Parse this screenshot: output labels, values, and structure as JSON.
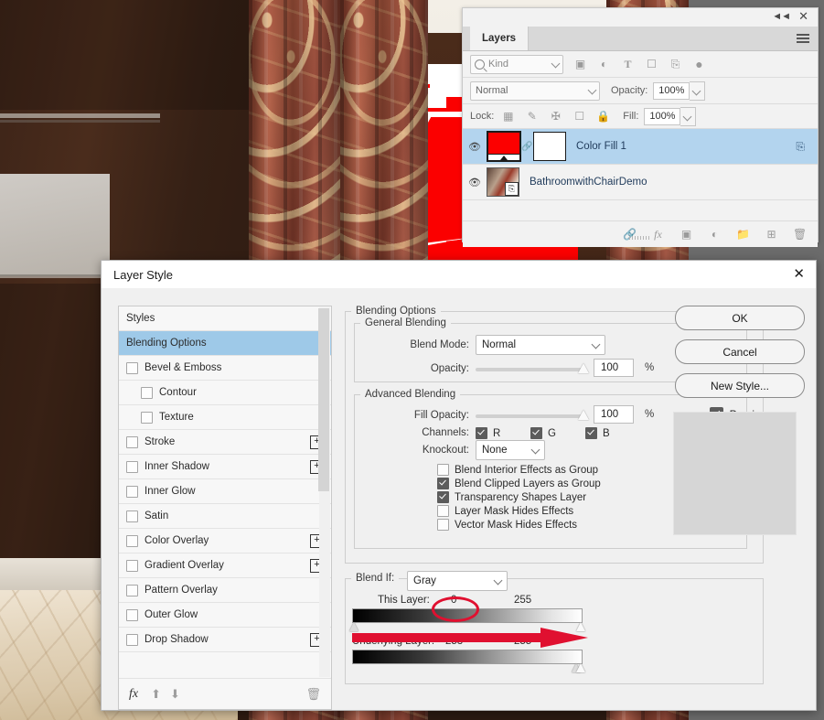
{
  "layers_panel": {
    "tab_label": "Layers",
    "collapse_icon": "double-chevron-left-icon",
    "close_icon": "close-icon",
    "menu_icon": "panel-menu-icon",
    "filter": {
      "search_icon": "search-icon",
      "kind_value": "Kind",
      "icons": [
        "image-filter-icon",
        "adjustment-filter-icon",
        "type-filter-icon",
        "shape-filter-icon",
        "smart-object-filter-icon",
        "filter-toggle-icon"
      ]
    },
    "blend": {
      "mode_value": "Normal",
      "opacity_label": "Opacity:",
      "opacity_value": "100%"
    },
    "lock": {
      "label": "Lock:",
      "icons": [
        "lock-transparent-pixels-icon",
        "lock-image-pixels-icon",
        "lock-position-icon",
        "lock-artboard-icon",
        "lock-all-icon"
      ],
      "fill_label": "Fill:",
      "fill_value": "100%"
    },
    "layers": [
      {
        "name": "Color Fill 1",
        "visible_icon": "eye-icon",
        "selected": true,
        "thumb": "red-fill-thumbnail",
        "mask_thumb": "white-mask-thumbnail",
        "link_icon": "link-mask-icon",
        "badge_icon": "clipping-indicator-icon"
      },
      {
        "name": "BathroomwithChairDemo",
        "visible_icon": "eye-icon",
        "selected": false,
        "thumb": "bathroom-photo-thumbnail",
        "badge_icon": "smart-object-badge-icon"
      }
    ],
    "bottom_icons": [
      "link-layers-icon",
      "add-layer-style-icon",
      "add-layer-mask-icon",
      "new-fill-adjustment-icon",
      "new-group-icon",
      "new-layer-icon",
      "delete-layer-icon"
    ]
  },
  "dialog": {
    "title": "Layer Style",
    "close_icon": "close-icon",
    "styles_panel": {
      "header": "Styles",
      "items": [
        {
          "label": "Blending Options",
          "active": true,
          "checkbox": false,
          "indent": false,
          "plus": false
        },
        {
          "label": "Bevel & Emboss",
          "active": false,
          "checkbox": true,
          "checked": false,
          "indent": false,
          "plus": false
        },
        {
          "label": "Contour",
          "active": false,
          "checkbox": true,
          "checked": false,
          "indent": true,
          "plus": false
        },
        {
          "label": "Texture",
          "active": false,
          "checkbox": true,
          "checked": false,
          "indent": true,
          "plus": false
        },
        {
          "label": "Stroke",
          "active": false,
          "checkbox": true,
          "checked": false,
          "indent": false,
          "plus": true
        },
        {
          "label": "Inner Shadow",
          "active": false,
          "checkbox": true,
          "checked": false,
          "indent": false,
          "plus": true
        },
        {
          "label": "Inner Glow",
          "active": false,
          "checkbox": true,
          "checked": false,
          "indent": false,
          "plus": false
        },
        {
          "label": "Satin",
          "active": false,
          "checkbox": true,
          "checked": false,
          "indent": false,
          "plus": false
        },
        {
          "label": "Color Overlay",
          "active": false,
          "checkbox": true,
          "checked": false,
          "indent": false,
          "plus": true
        },
        {
          "label": "Gradient Overlay",
          "active": false,
          "checkbox": true,
          "checked": false,
          "indent": false,
          "plus": true
        },
        {
          "label": "Pattern Overlay",
          "active": false,
          "checkbox": true,
          "checked": false,
          "indent": false,
          "plus": false
        },
        {
          "label": "Outer Glow",
          "active": false,
          "checkbox": true,
          "checked": false,
          "indent": false,
          "plus": false
        },
        {
          "label": "Drop Shadow",
          "active": false,
          "checkbox": true,
          "checked": false,
          "indent": false,
          "plus": true
        }
      ],
      "footer_icons": [
        "fx-icon",
        "move-up-icon",
        "move-down-icon",
        "delete-icon"
      ]
    },
    "blending_options": {
      "legend": "Blending Options",
      "general": {
        "legend": "General Blending",
        "blend_mode_label": "Blend Mode:",
        "blend_mode_value": "Normal",
        "opacity_label": "Opacity:",
        "opacity_value": "100",
        "opacity_unit": "%"
      },
      "advanced": {
        "legend": "Advanced Blending",
        "fill_opacity_label": "Fill Opacity:",
        "fill_opacity_value": "100",
        "fill_opacity_unit": "%",
        "channels_label": "Channels:",
        "channels": [
          {
            "label": "R",
            "checked": true
          },
          {
            "label": "G",
            "checked": true
          },
          {
            "label": "B",
            "checked": true
          }
        ],
        "knockout_label": "Knockout:",
        "knockout_value": "None",
        "options": [
          {
            "label": "Blend Interior Effects as Group",
            "checked": false
          },
          {
            "label": "Blend Clipped Layers as Group",
            "checked": true
          },
          {
            "label": "Transparency Shapes Layer",
            "checked": true
          },
          {
            "label": "Layer Mask Hides Effects",
            "checked": false
          },
          {
            "label": "Vector Mask Hides Effects",
            "checked": false
          }
        ]
      },
      "blend_if": {
        "label": "Blend If:",
        "channel_value": "Gray",
        "this_layer": {
          "label": "This Layer:",
          "min": "0",
          "max": "255"
        },
        "underlying_layer": {
          "label": "Underlying Layer:",
          "min": "253",
          "max": "255"
        }
      }
    },
    "buttons": {
      "ok": "OK",
      "cancel": "Cancel",
      "new_style": "New Style...",
      "preview_label": "Preview",
      "preview_checked": true
    }
  },
  "annotations": {
    "highlight_color": "#e01030",
    "ellipse_target": "underlying-layer-min-value",
    "arrow_target": "underlying-layer-black-slider"
  }
}
